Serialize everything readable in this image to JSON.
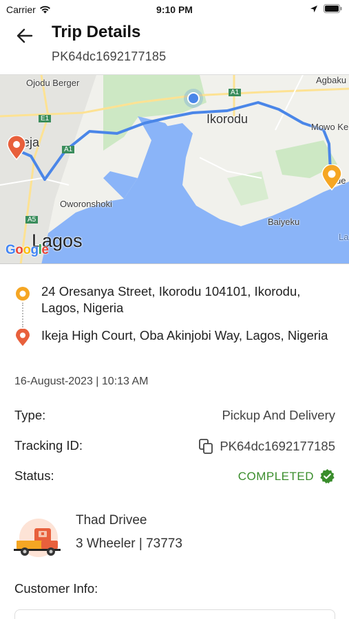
{
  "status_bar": {
    "carrier": "Carrier",
    "time": "9:10 PM"
  },
  "header": {
    "title": "Trip Details",
    "trip_id": "PK64dc1692177185"
  },
  "map": {
    "labels": {
      "ojodu_berger": "Ojodu Berger",
      "ikorodu": "Ikorodu",
      "agbaku": "Agbaku",
      "mowo_ke": "Mowo Ke",
      "ikeja": "eja",
      "oworonshoki": "Oworonshoki",
      "lagos": "Lagos",
      "baiyeku": "Baiyeku",
      "road_e1": "E1",
      "road_a1_left": "A1",
      "road_a1_top": "A1",
      "road_a5": "A5",
      "la": "La",
      "de": "de"
    },
    "google": [
      "G",
      "o",
      "o",
      "g",
      "l",
      "e"
    ]
  },
  "route": {
    "pickup": "24 Oresanya Street, Ikorodu 104101, Ikorodu, Lagos, Nigeria",
    "dropoff": "Ikeja High Court, Oba Akinjobi Way, Lagos, Nigeria"
  },
  "datetime": "16-August-2023 | 10:13 AM",
  "details": {
    "type_label": "Type:",
    "type_value": "Pickup And Delivery",
    "tracking_label": "Tracking ID:",
    "tracking_value": "PK64dc1692177185",
    "status_label": "Status:",
    "status_value": "COMPLETED"
  },
  "driver": {
    "name": "Thad Drivee",
    "vehicle": "3 Wheeler | 73773"
  },
  "customer": {
    "title": "Customer Info:"
  },
  "colors": {
    "route_line": "#4a86e8",
    "pickup_pin": "#f5a623",
    "dropoff_pin": "#e8603c",
    "status_green": "#3a8d2c",
    "water": "#8ab4f8",
    "land": "#f1f1ec",
    "park": "#cde8c4"
  }
}
